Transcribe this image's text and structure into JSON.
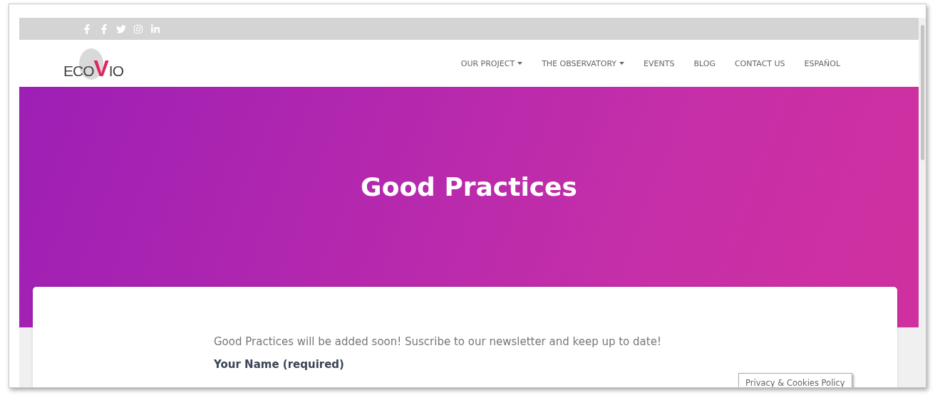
{
  "social_links": [
    {
      "kind": "facebook"
    },
    {
      "kind": "facebook"
    },
    {
      "kind": "twitter"
    },
    {
      "kind": "instagram"
    },
    {
      "kind": "linkedin"
    }
  ],
  "logo": {
    "before": "ECO",
    "accent": "V",
    "after": "IO"
  },
  "nav": [
    {
      "label": "OUR PROJECT",
      "dropdown": true
    },
    {
      "label": "THE OBSERVATORY",
      "dropdown": true
    },
    {
      "label": "EVENTS",
      "dropdown": false
    },
    {
      "label": "BLOG",
      "dropdown": false
    },
    {
      "label": "CONTACT US",
      "dropdown": false
    },
    {
      "label": "ESPAÑOL",
      "dropdown": false
    }
  ],
  "hero": {
    "title": "Good Practices"
  },
  "content": {
    "intro": "Good Practices will be added soon! Suscribe to our newsletter and keep up to date!",
    "name_label": "Your Name (required)"
  },
  "privacy_button": "Privacy & Cookies Policy"
}
